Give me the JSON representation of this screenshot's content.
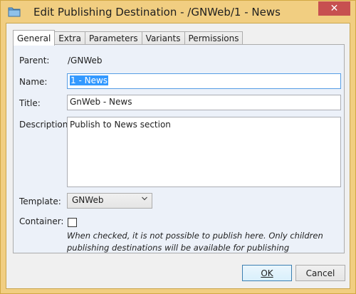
{
  "window": {
    "title": "Edit Publishing Destination - /GNWeb/1 - News",
    "close_symbol": "✕",
    "icon": "folder-icon"
  },
  "tabs": [
    {
      "label": "General",
      "active": true
    },
    {
      "label": "Extra"
    },
    {
      "label": "Parameters"
    },
    {
      "label": "Variants"
    },
    {
      "label": "Permissions"
    }
  ],
  "form": {
    "parent_label": "Parent:",
    "parent_value": "/GNWeb",
    "name_label": "Name:",
    "name_value": "1 - News",
    "title_label": "Title:",
    "title_value": "GnWeb - News",
    "description_label": "Description:",
    "description_value": "Publish to News section",
    "template_label": "Template:",
    "template_value": "GNWeb",
    "container_label": "Container:",
    "container_hint": "When checked, it is not possible to publish here. Only children publishing destinations will be available for publishing"
  },
  "buttons": {
    "ok_label": "OK",
    "cancel_label": "Cancel"
  }
}
